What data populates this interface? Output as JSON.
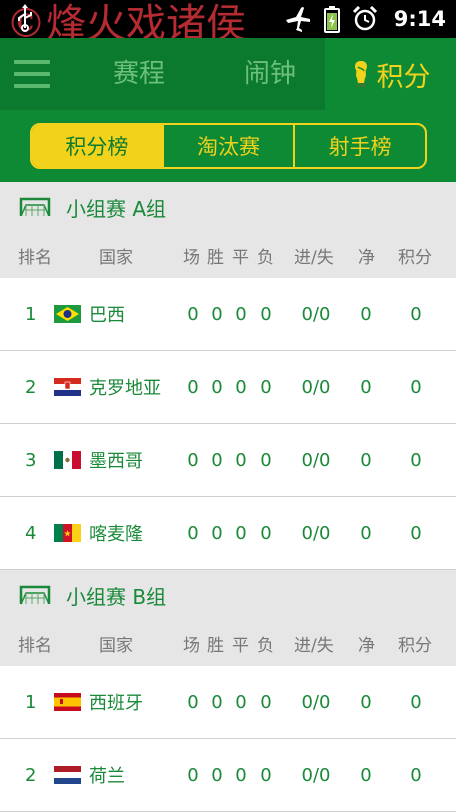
{
  "status_bar": {
    "time": "9:14",
    "watermark": "©烽火戏诸侯"
  },
  "nav": {
    "tabs": [
      {
        "label": "赛程"
      },
      {
        "label": "闹钟"
      },
      {
        "label": "积分"
      }
    ]
  },
  "segments": [
    "积分榜",
    "淘汰赛",
    "射手榜"
  ],
  "columns": {
    "rank": "排名",
    "country": "国家",
    "played": "场",
    "won": "胜",
    "drawn": "平",
    "lost": "负",
    "goals": "进/失",
    "diff": "净",
    "points": "积分"
  },
  "colors": {
    "green": "#0e8a35",
    "dark_green": "#0b7a2e",
    "yellow": "#f2d21b",
    "text_green": "#1a8a3a"
  },
  "groups": [
    {
      "title": "小组赛 A组",
      "teams": [
        {
          "rank": "1",
          "flag": "brazil-flag",
          "name": "巴西",
          "played": "0",
          "won": "0",
          "drawn": "0",
          "lost": "0",
          "goals": "0/0",
          "diff": "0",
          "points": "0"
        },
        {
          "rank": "2",
          "flag": "croatia-flag",
          "name": "克罗地亚",
          "played": "0",
          "won": "0",
          "drawn": "0",
          "lost": "0",
          "goals": "0/0",
          "diff": "0",
          "points": "0"
        },
        {
          "rank": "3",
          "flag": "mexico-flag",
          "name": "墨西哥",
          "played": "0",
          "won": "0",
          "drawn": "0",
          "lost": "0",
          "goals": "0/0",
          "diff": "0",
          "points": "0"
        },
        {
          "rank": "4",
          "flag": "cameroon-flag",
          "name": "喀麦隆",
          "played": "0",
          "won": "0",
          "drawn": "0",
          "lost": "0",
          "goals": "0/0",
          "diff": "0",
          "points": "0"
        }
      ]
    },
    {
      "title": "小组赛 B组",
      "teams": [
        {
          "rank": "1",
          "flag": "spain-flag",
          "name": "西班牙",
          "played": "0",
          "won": "0",
          "drawn": "0",
          "lost": "0",
          "goals": "0/0",
          "diff": "0",
          "points": "0"
        },
        {
          "rank": "2",
          "flag": "netherlands-flag",
          "name": "荷兰",
          "played": "0",
          "won": "0",
          "drawn": "0",
          "lost": "0",
          "goals": "0/0",
          "diff": "0",
          "points": "0"
        }
      ]
    }
  ]
}
